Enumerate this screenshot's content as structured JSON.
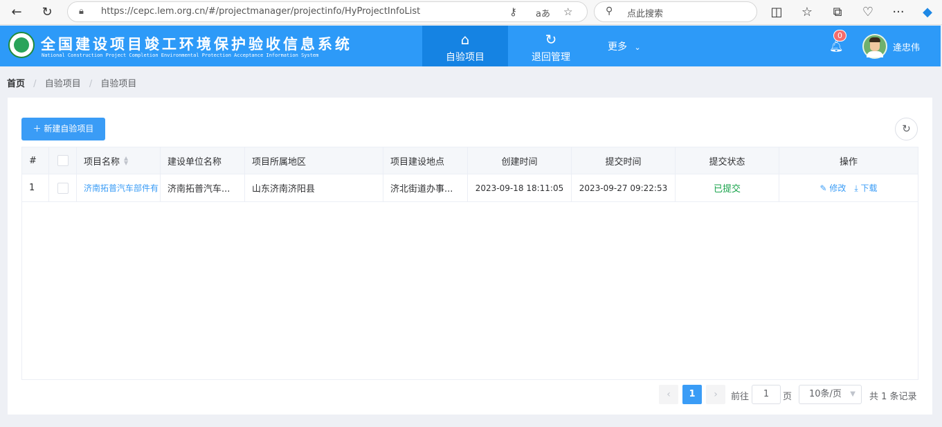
{
  "browser": {
    "url": "https://cepc.lem.org.cn/#/projectmanager/projectinfo/HyProjectInfoList",
    "search_placeholder": "点此搜索"
  },
  "header": {
    "title_cn": "全国建设项目竣工环境保护验收信息系统",
    "title_en": "National Construction Project Completion Environmental Protection Acceptance Information System",
    "nav": [
      {
        "label": "自验项目",
        "icon": "home-icon",
        "active": true
      },
      {
        "label": "退回管理",
        "icon": "undo-icon",
        "active": false
      }
    ],
    "more_label": "更多",
    "notification_count": "0",
    "username": "逄忠伟"
  },
  "breadcrumb": {
    "home": "首页",
    "items": [
      "自验项目",
      "自验项目"
    ]
  },
  "toolbar": {
    "new_button": "新建自验项目"
  },
  "table": {
    "columns": [
      "#",
      "",
      "项目名称",
      "建设单位名称",
      "项目所属地区",
      "项目建设地点",
      "创建时间",
      "提交时间",
      "提交状态",
      "操作"
    ],
    "rows": [
      {
        "index": "1",
        "project_name": "济南拓普汽车部件有",
        "builder": "济南拓普汽车...",
        "region": "山东济南济阳县",
        "location": "济北街道办事...",
        "created": "2023-09-18 18:11:05",
        "submitted": "2023-09-27 09:22:53",
        "status": "已提交",
        "edit": "修改",
        "download": "下载"
      }
    ]
  },
  "pagination": {
    "current_page": "1",
    "goto_prefix": "前往",
    "goto_value": "1",
    "goto_suffix": "页",
    "page_size": "10条/页",
    "total": "共 1 条记录"
  },
  "colors": {
    "header_bg": "#2d9af8",
    "active_nav_bg": "#1583e3",
    "primary": "#3a9cf6",
    "status_green": "#17a34a",
    "badge_red": "#f56c6c"
  }
}
